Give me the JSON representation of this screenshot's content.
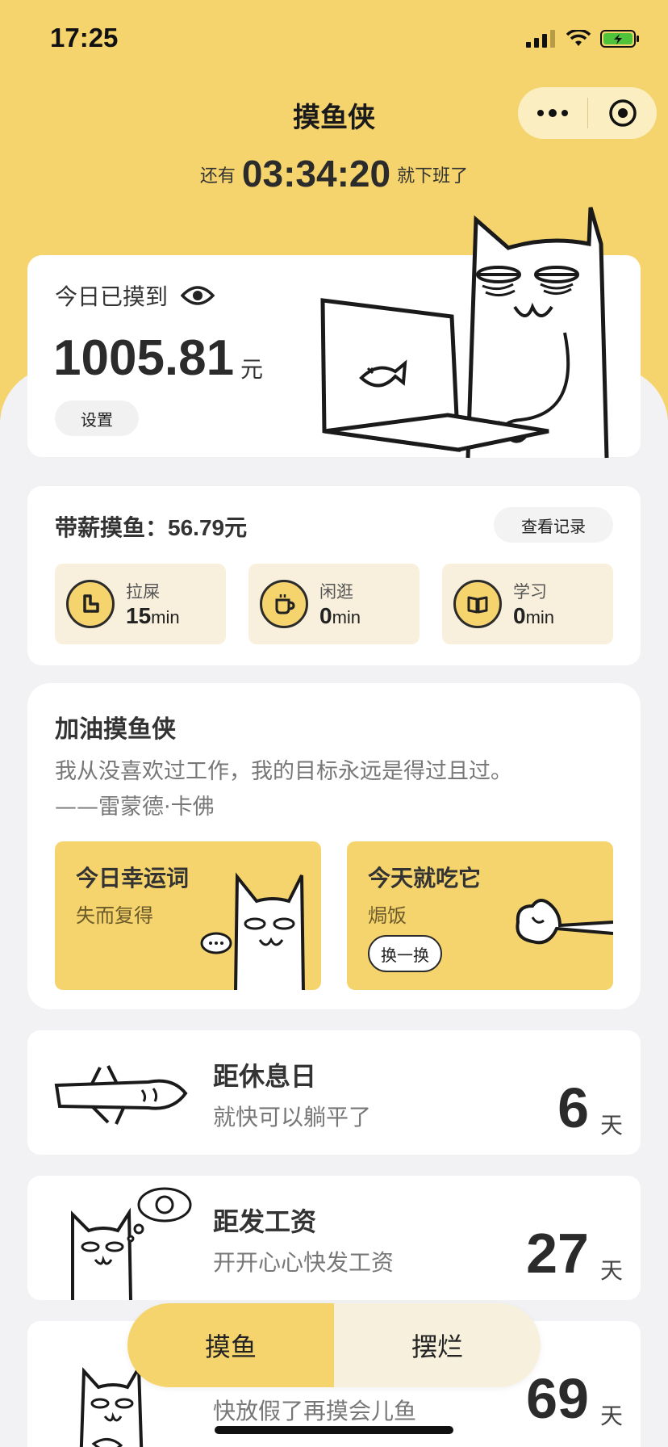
{
  "status_bar": {
    "time": "17:25"
  },
  "header": {
    "title": "摸鱼侠"
  },
  "countdown": {
    "prefix": "还有",
    "time": "03:34:20",
    "suffix": "就下班了"
  },
  "earnings": {
    "label": "今日已摸到",
    "value": "1005.81",
    "unit": "元",
    "settings_label": "设置"
  },
  "paid_slacking": {
    "label": "带薪摸鱼：",
    "amount": "56.79元",
    "record_button": "查看记录",
    "activities": [
      {
        "name": "拉屎",
        "value": "15",
        "unit": "min",
        "icon": "toilet-icon"
      },
      {
        "name": "闲逛",
        "value": "0",
        "unit": "min",
        "icon": "coffee-icon"
      },
      {
        "name": "学习",
        "value": "0",
        "unit": "min",
        "icon": "book-icon"
      }
    ]
  },
  "cheer": {
    "title": "加油摸鱼侠",
    "quote_line1": "我从没喜欢过工作，我的目标永远是得过且过。",
    "quote_line2": "——雷蒙德·卡佛",
    "lucky": {
      "title": "今日幸运词",
      "word": "失而复得"
    },
    "food": {
      "title": "今天就吃它",
      "dish": "焗饭",
      "swap_button": "换一换"
    }
  },
  "countdowns": [
    {
      "title": "距休息日",
      "subtitle": "就快可以躺平了",
      "days": "6",
      "unit": "天"
    },
    {
      "title": "距发工资",
      "subtitle": "开开心心快发工资",
      "days": "27",
      "unit": "天"
    },
    {
      "title": "",
      "subtitle": "快放假了再摸会儿鱼",
      "days": "69",
      "unit": "天"
    }
  ],
  "tabs": [
    {
      "label": "摸鱼",
      "active": true
    },
    {
      "label": "摆烂",
      "active": false
    }
  ],
  "colors": {
    "brand_yellow": "#f6d46d",
    "background": "#f2f2f4",
    "text_dark": "#2b2b2b"
  }
}
